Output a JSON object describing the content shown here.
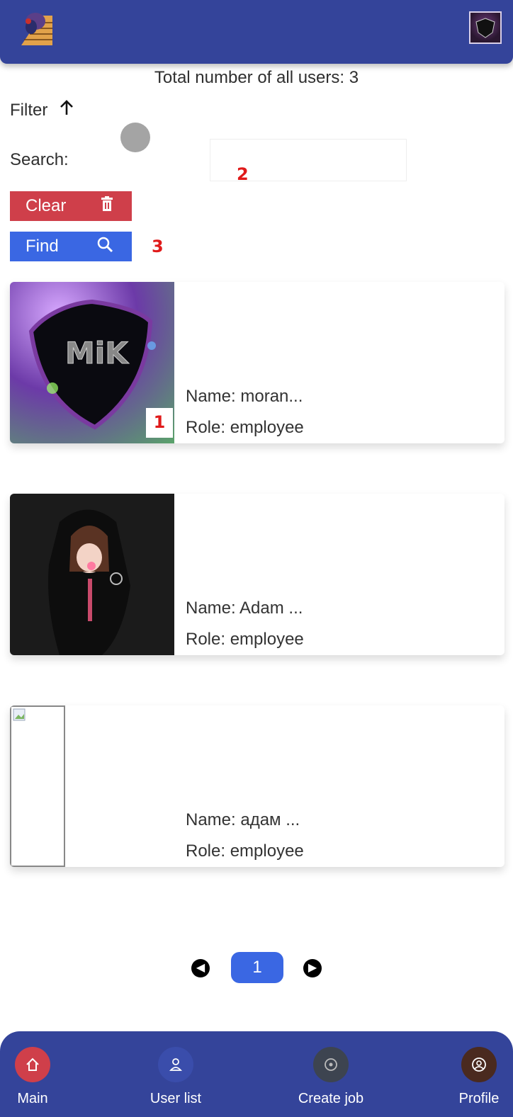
{
  "header": {
    "logo_icon": "brick-mascot-logo-icon",
    "avatar_icon": "profile-avatar-icon"
  },
  "summary": {
    "total_users": "Total number of all users: 3"
  },
  "filter": {
    "label": "Filter",
    "toggle_icon": "arrow-up-icon"
  },
  "search": {
    "label": "Search:",
    "value": "",
    "placeholder": ""
  },
  "buttons": {
    "clear_label": "Clear",
    "clear_icon": "trash-icon",
    "find_label": "Find",
    "find_icon": "search-icon"
  },
  "markers": {
    "m1": "1",
    "m2": "2",
    "m3": "3"
  },
  "users": [
    {
      "name": "Name: moran...",
      "role": "Role: employee",
      "image": "mk-shield-avatar"
    },
    {
      "name": "Name: Adam ...",
      "role": "Role: employee",
      "image": "anime-girl-avatar"
    },
    {
      "name": "Name: адам ...",
      "role": "Role: employee",
      "image": "broken-image"
    }
  ],
  "pagination": {
    "prev_icon": "arrow-left-icon",
    "current_page": "1",
    "next_icon": "arrow-right-icon"
  },
  "bottom_nav": [
    {
      "label": "Main",
      "icon": "home-icon",
      "color": "#cf3f4a"
    },
    {
      "label": "User list",
      "icon": "user-icon",
      "color": "#3a4dab"
    },
    {
      "label": "Create job",
      "icon": "target-icon",
      "color": "#3d4450"
    },
    {
      "label": "Profile",
      "icon": "profile-icon",
      "color": "#4a2a1f"
    }
  ]
}
